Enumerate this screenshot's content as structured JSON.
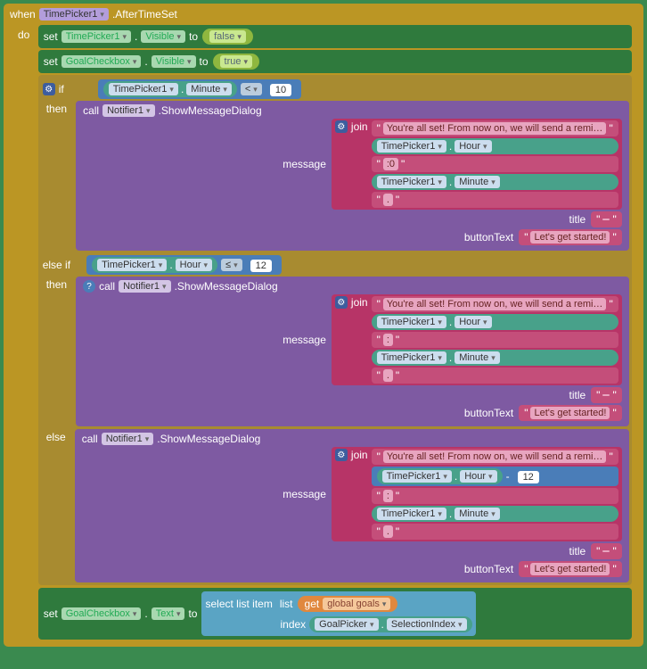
{
  "header": {
    "when": "when",
    "component": "TimePicker1",
    "event": ".AfterTimeSet"
  },
  "do_label": "do",
  "set1": {
    "kw": "set",
    "comp": "TimePicker1",
    "prop": "Visible",
    "to": "to",
    "val": "false"
  },
  "set2": {
    "kw": "set",
    "comp": "GoalCheckbox",
    "prop": "Visible",
    "to": "to",
    "val": "true"
  },
  "if_kw": "if",
  "elseif_kw": "else if",
  "else_kw": "else",
  "then_kw": "then",
  "cond1": {
    "comp": "TimePicker1",
    "prop": "Minute",
    "op": "<",
    "num": "10"
  },
  "cond2": {
    "comp": "TimePicker1",
    "prop": "Hour",
    "op": "≤",
    "num": "12"
  },
  "call": {
    "kw": "call",
    "comp": "Notifier1",
    "method": ".ShowMessageDialog"
  },
  "args": {
    "message": "message",
    "title": "title",
    "buttonText": "buttonText"
  },
  "join_kw": "join",
  "longmsg": "You're all set! From now on, we will send a remi…",
  "tp": "TimePicker1",
  "hour": "Hour",
  "minute": "Minute",
  "colon0": ":0",
  "colon": ":",
  "period": ".",
  "blank": "",
  "spacedot": " ",
  "btn_text": "Let's get started!",
  "minus": "-",
  "twelve": "12",
  "set3": {
    "kw": "set",
    "comp": "GoalCheckbox",
    "prop": "Text",
    "to": "to"
  },
  "listop": {
    "kw": "select list item",
    "list": "list",
    "index": "index"
  },
  "get": {
    "kw": "get",
    "var": "global goals"
  },
  "gp": {
    "comp": "GoalPicker",
    "prop": "SelectionIndex"
  }
}
